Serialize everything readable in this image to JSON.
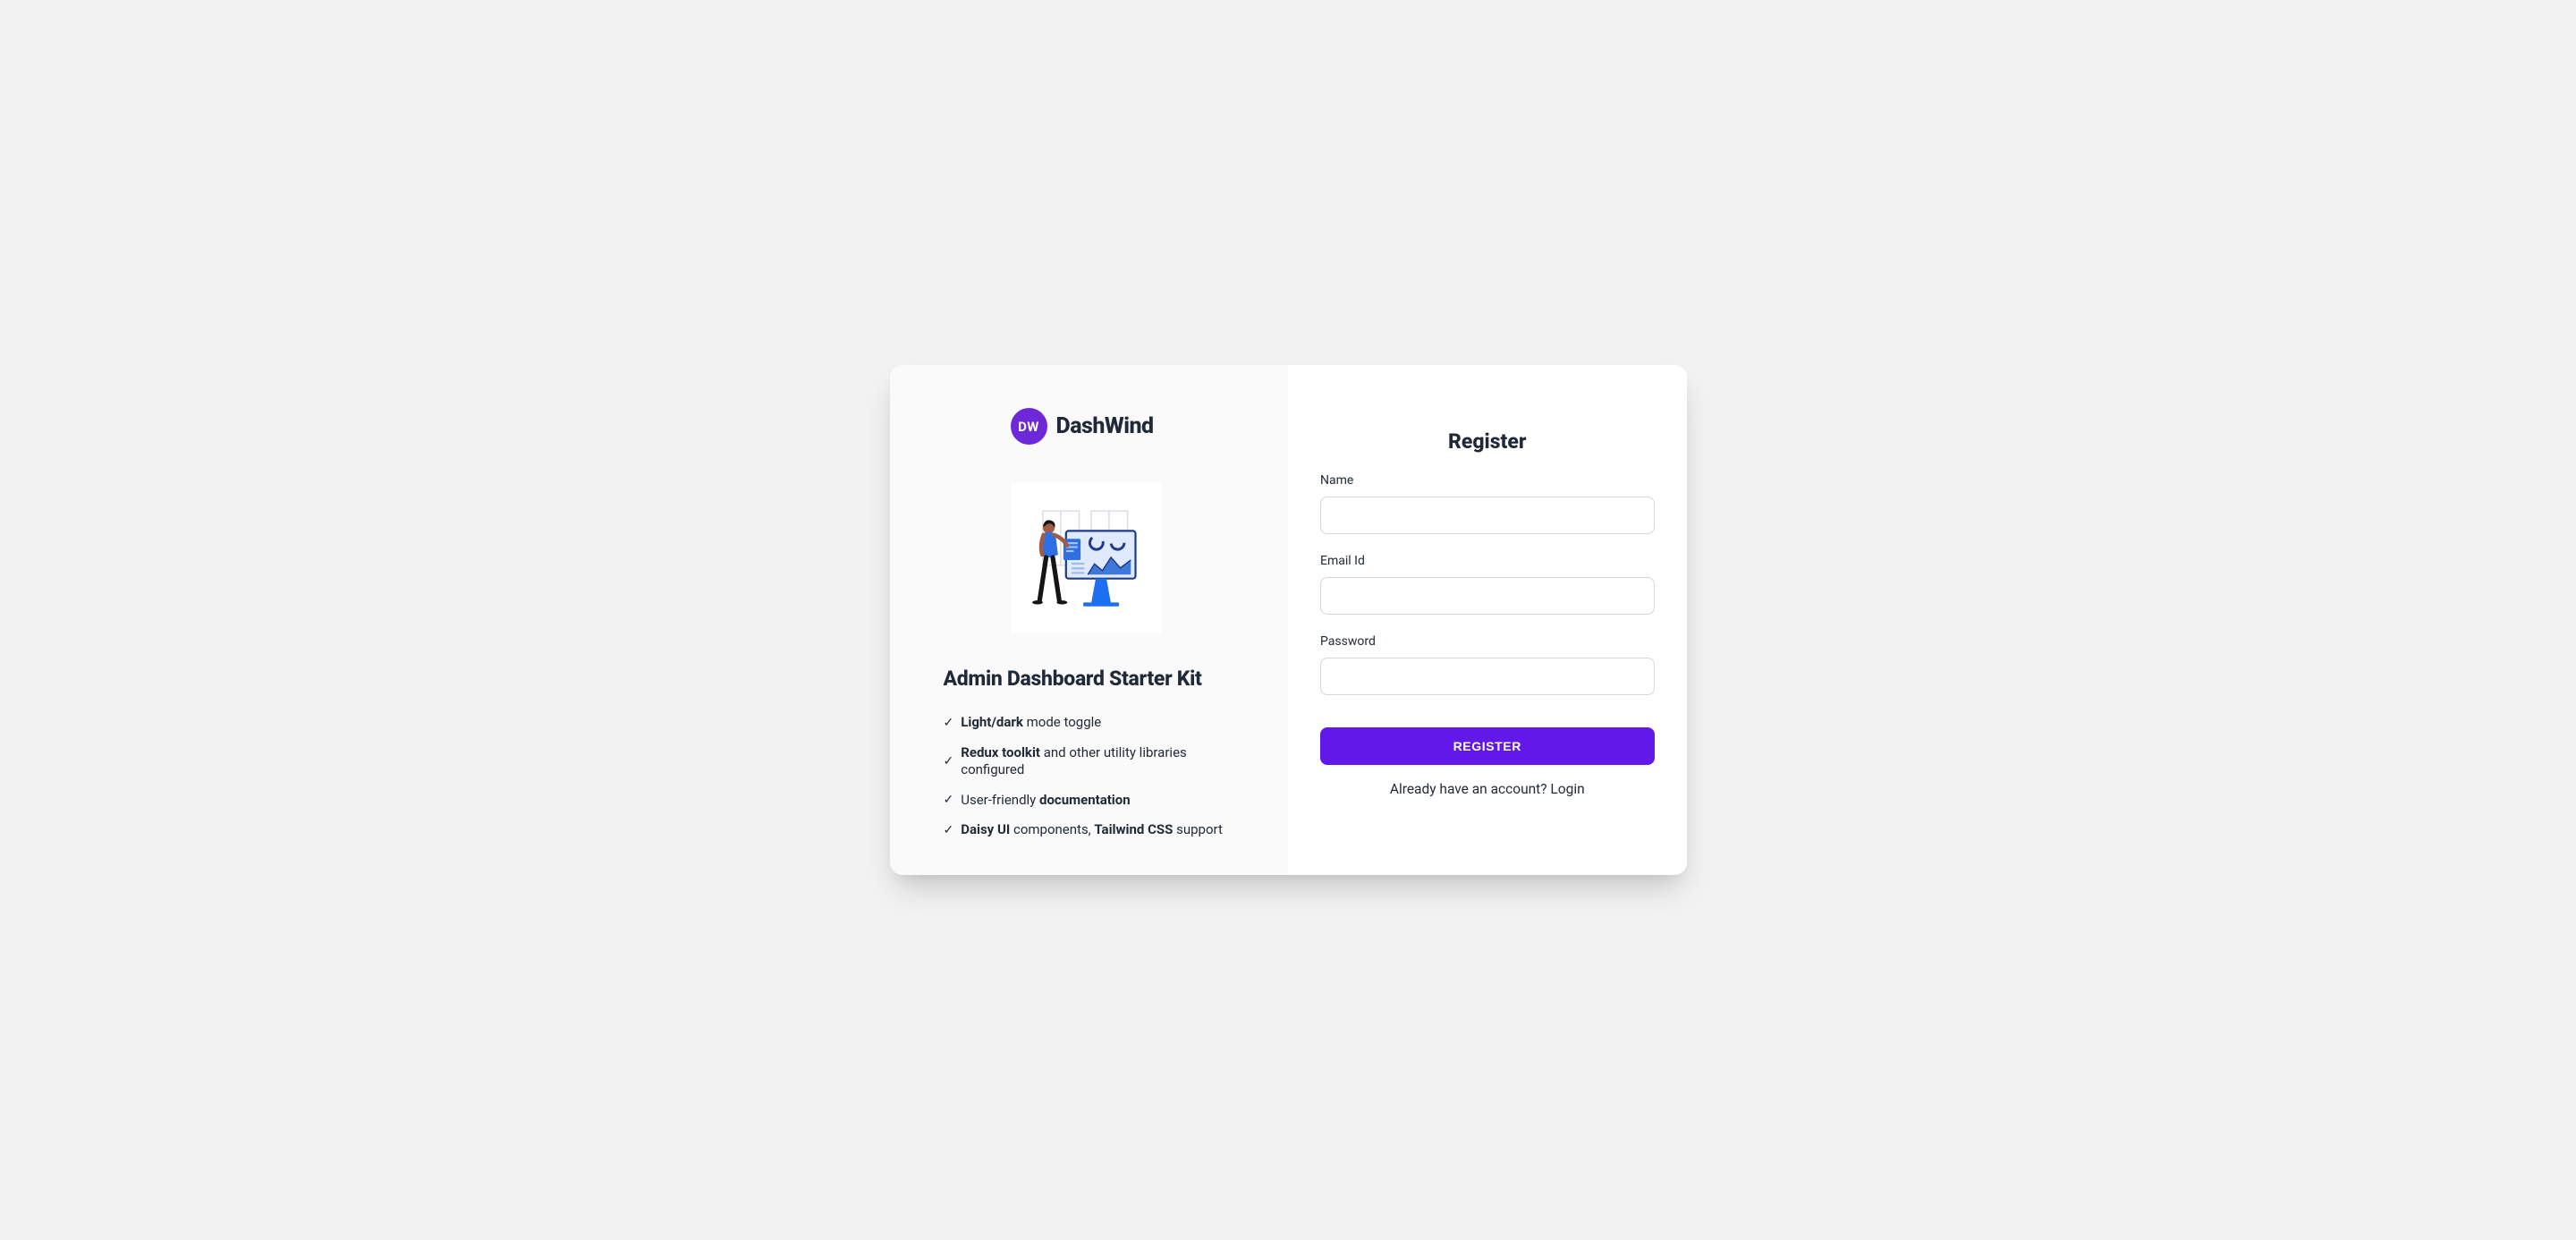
{
  "brand": {
    "badge": "DW",
    "name": "DashWind"
  },
  "intro": {
    "headline": "Admin Dashboard Starter Kit",
    "features": [
      {
        "prefix": "",
        "bold1": "Light/dark",
        "mid": " mode toggle",
        "bold2": "",
        "suffix": ""
      },
      {
        "prefix": "",
        "bold1": "Redux toolkit",
        "mid": " and other utility libraries configured",
        "bold2": "",
        "suffix": ""
      },
      {
        "prefix": "User-friendly ",
        "bold1": "documentation",
        "mid": "",
        "bold2": "",
        "suffix": ""
      },
      {
        "prefix": "",
        "bold1": "Daisy UI",
        "mid": " components, ",
        "bold2": "Tailwind CSS",
        "suffix": " support"
      }
    ]
  },
  "form": {
    "title": "Register",
    "name_label": "Name",
    "name_value": "",
    "email_label": "Email Id",
    "email_value": "",
    "password_label": "Password",
    "password_value": "",
    "submit_label": "Register",
    "alt_prompt": "Already have an account? ",
    "alt_link": "Login"
  },
  "colors": {
    "brand_purple": "#6d28d9",
    "button_purple": "#6118e8",
    "text_dark": "#1f2937"
  }
}
